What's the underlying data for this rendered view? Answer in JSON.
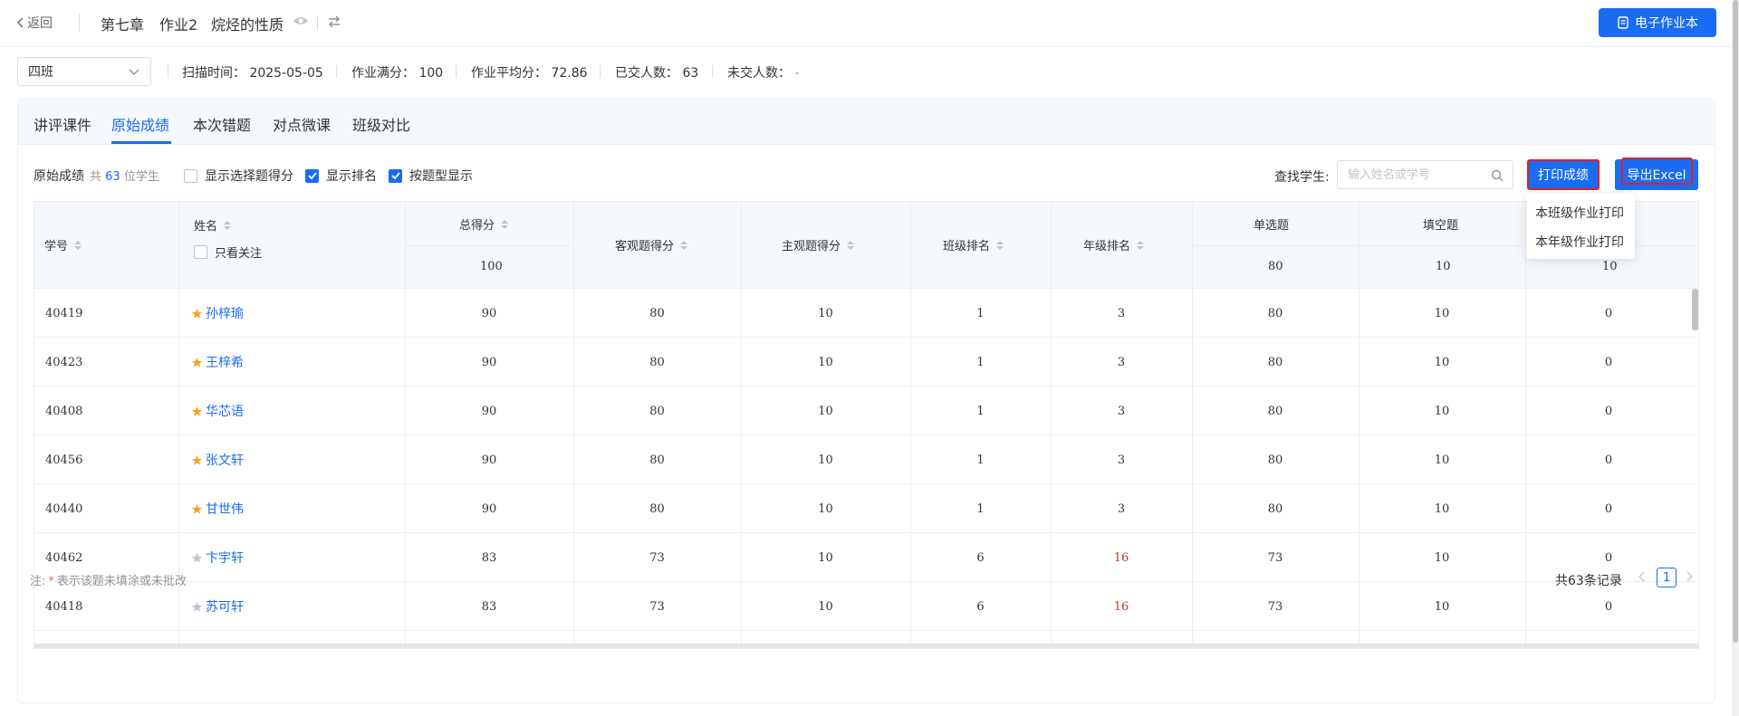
{
  "header": {
    "back_label": "返回",
    "chapter": "第七章",
    "homework": "作业2",
    "title": "烷烃的性质",
    "ebook_label": "电子作业本"
  },
  "info": {
    "class_selected": "四班",
    "scan_time": "扫描时间：  2025-05-05",
    "full_score": "作业满分：  100",
    "avg_score": "作业平均分：  72.86",
    "submitted": "已交人数：  63",
    "not_submitted_label": "未交人数：",
    "not_submitted_value": "-"
  },
  "tabs": [
    "讲评课件",
    "原始成绩",
    "本次错题",
    "对点微课",
    "班级对比"
  ],
  "active_tab": 1,
  "toolbar": {
    "title": "原始成绩",
    "count_prefix": "共",
    "count": "63",
    "count_suffix": "位学生",
    "cb_choice_score": "显示选择题得分",
    "cb_rank": "显示排名",
    "cb_by_type": "按题型显示",
    "find_label": "查找学生:",
    "search_placeholder": "输入姓名或学号",
    "print_label": "打印成绩",
    "export_label": "导出Excel"
  },
  "dropdown": [
    "本班级作业打印",
    "本年级作业打印"
  ],
  "table": {
    "headers": {
      "id": "学号",
      "name": "姓名",
      "follow_only": "只看关注",
      "total": "总得分",
      "total_full": "100",
      "objective": "客观题得分",
      "subjective": "主观题得分",
      "class_rank": "班级排名",
      "grade_rank": "年级排名",
      "single": "单选题",
      "single_full": "80",
      "fill": "填空题",
      "fill_full": "10",
      "last_full": "10"
    },
    "rows": [
      {
        "id": "40419",
        "name": "孙梓瑜",
        "star": true,
        "total": "90",
        "obj": "80",
        "subj": "10",
        "crank": "1",
        "grank": "3",
        "single": "80",
        "fill": "10",
        "last": "0"
      },
      {
        "id": "40423",
        "name": "王梓希",
        "star": true,
        "total": "90",
        "obj": "80",
        "subj": "10",
        "crank": "1",
        "grank": "3",
        "single": "80",
        "fill": "10",
        "last": "0"
      },
      {
        "id": "40408",
        "name": "华芯语",
        "star": true,
        "total": "90",
        "obj": "80",
        "subj": "10",
        "crank": "1",
        "grank": "3",
        "single": "80",
        "fill": "10",
        "last": "0"
      },
      {
        "id": "40456",
        "name": "张文轩",
        "star": true,
        "total": "90",
        "obj": "80",
        "subj": "10",
        "crank": "1",
        "grank": "3",
        "single": "80",
        "fill": "10",
        "last": "0"
      },
      {
        "id": "40440",
        "name": "甘世伟",
        "star": true,
        "total": "90",
        "obj": "80",
        "subj": "10",
        "crank": "1",
        "grank": "3",
        "single": "80",
        "fill": "10",
        "last": "0"
      },
      {
        "id": "40462",
        "name": "卞宇轩",
        "star": false,
        "total": "83",
        "obj": "73",
        "subj": "10",
        "crank": "6",
        "grank": "16",
        "single": "73",
        "fill": "10",
        "last": "0"
      },
      {
        "id": "40418",
        "name": "苏可轩",
        "star": false,
        "total": "83",
        "obj": "73",
        "subj": "10",
        "crank": "6",
        "grank": "16",
        "single": "73",
        "fill": "10",
        "last": "0"
      }
    ]
  },
  "footer": {
    "note_prefix": "注:",
    "note_star": "*",
    "note_text": "表示该题未填涂或未批改",
    "total_records": "共63条记录",
    "page": "1"
  },
  "colors": {
    "primary": "#1a6cf2",
    "highlight": "#e02020",
    "star_on": "#f5a623",
    "star_off": "#c0c4cc"
  }
}
